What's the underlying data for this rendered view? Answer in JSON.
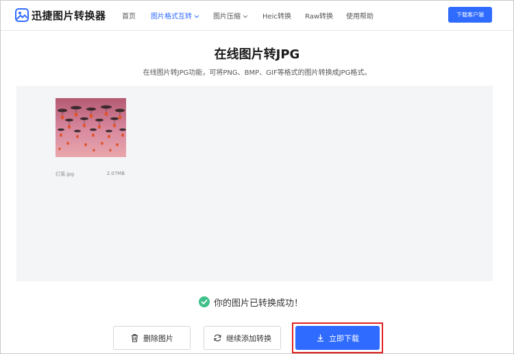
{
  "header": {
    "brand": "迅捷图片转换器",
    "nav": [
      {
        "label": "首页",
        "active": false
      },
      {
        "label": "图片格式互转",
        "active": true,
        "has_dropdown": true
      },
      {
        "label": "图片压缩",
        "active": false,
        "has_dropdown": true
      },
      {
        "label": "Heic转换",
        "active": false
      },
      {
        "label": "Raw转换",
        "active": false
      },
      {
        "label": "使用帮助",
        "active": false
      }
    ],
    "download_client_label": "下载客户端"
  },
  "page": {
    "title": "在线图片转JPG",
    "subtitle": "在线图片转JPG功能，可将PNG、BMP、GIF等格式的图片转换成JPG格式。"
  },
  "file": {
    "name": "灯笼.jpg",
    "size": "2.07MB",
    "thumbnail_icon": "lanterns-photo"
  },
  "status": {
    "message": "你的图片已转换成功！",
    "icon": "check-circle-icon",
    "color": "#3fbf8a"
  },
  "actions": {
    "delete_label": "删除图片",
    "add_more_label": "继续添加转换",
    "download_label": "立即下载"
  },
  "colors": {
    "accent": "#2f6bff",
    "highlight": "#e02020"
  }
}
